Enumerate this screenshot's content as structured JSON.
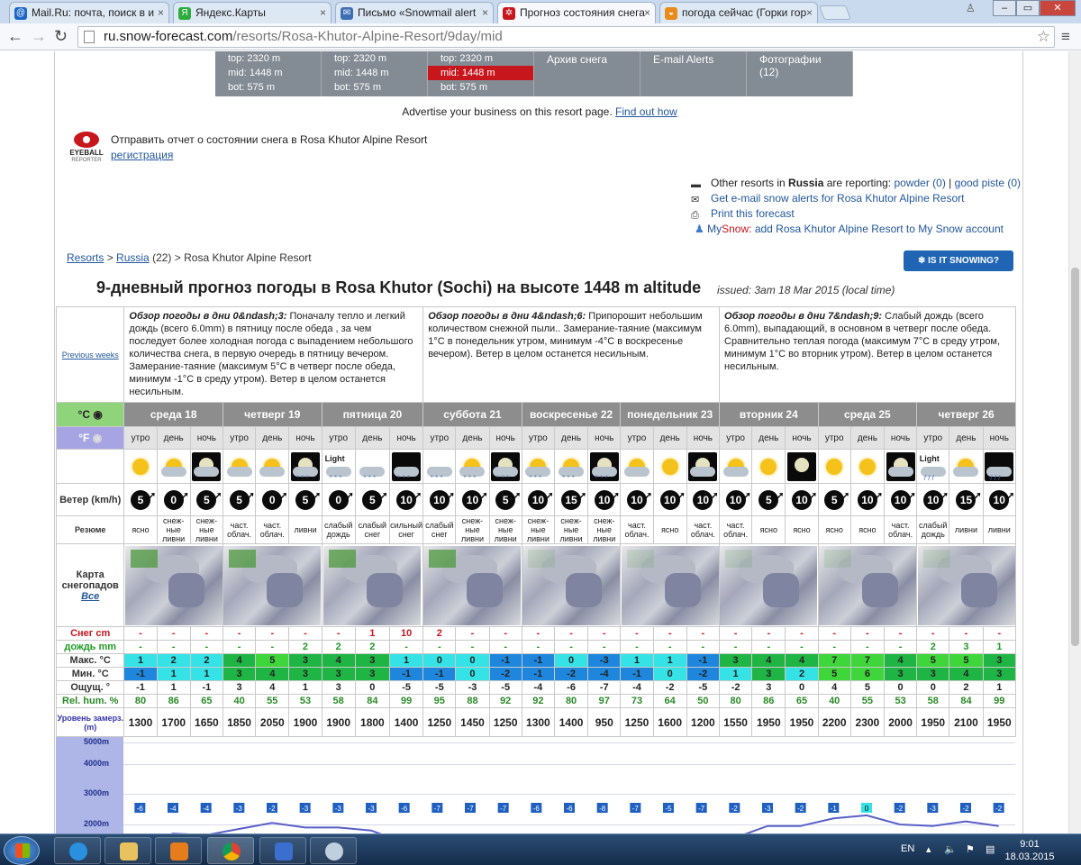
{
  "browser": {
    "tabs": [
      {
        "label": "Mail.Ru: почта, поиск в и",
        "icon_color": "#1b67c7",
        "icon": "@",
        "active": false
      },
      {
        "label": "Яндекс.Карты",
        "icon_color": "#2bac3b",
        "icon": "Я",
        "active": false
      },
      {
        "label": "Письмо «Snowmail alert",
        "icon_color": "#3f6fb3",
        "icon": "✉",
        "active": false
      },
      {
        "label": "Прогноз состояния снега",
        "icon_color": "#c8161d",
        "icon": "✲",
        "active": true
      },
      {
        "label": "погода сейчас (Горки гор",
        "icon_color": "#e88b1a",
        "icon": "◒",
        "active": false
      }
    ],
    "url_host": "ru.snow-forecast.com",
    "url_path": "/resorts/Rosa-Khutor-Alpine-Resort/9day/mid",
    "back_icon": "back-arrow-icon",
    "forward_icon": "forward-arrow-icon",
    "reload_icon": "reload-icon"
  },
  "resort_nav": [
    [
      "top: 2320 m",
      "mid: 1448 m",
      "bot: 575 m"
    ],
    [
      "top: 2320 m",
      "mid: 1448 m",
      "bot: 575 m"
    ],
    [
      "top: 2320 m",
      "mid: 1448 m",
      "bot: 575 m"
    ]
  ],
  "resort_links": [
    "Архив снега",
    "E-mail Alerts",
    "Фотографии (12)"
  ],
  "advertise": {
    "text": "Advertise your business on this resort page.",
    "link": "Find out how"
  },
  "eyeball": {
    "logo_top": "EYEBALL",
    "logo_bottom": "REPORTER",
    "text": "Отправить отчет о состоянии снега в Rosa Khutor Alpine Resort",
    "link": "регистрация"
  },
  "other": {
    "p1": "Other resorts in",
    "country": "Russia",
    "p2": "are reporting:",
    "powder": "powder (0)",
    "sep": "|",
    "piste": "good piste (0)",
    "alerts": "Get e-mail snow alerts for Rosa Khutor Alpine Resort",
    "print": "Print this forecast",
    "mysnow_a": "My",
    "mysnow_b": "Snow:",
    "mysnow_c": "add Rosa Khutor Alpine Resort to My Snow account"
  },
  "crumbs": {
    "resorts": "Resorts",
    "sep1": ">",
    "russia": "Russia",
    "count": "(22)",
    "sep2": ">",
    "resort": "Rosa Khutor Alpine Resort"
  },
  "is_snowing": "❄ IS IT SNOWING?",
  "title": "9-дневный прогноз погоды в Rosa Khutor (Sochi) на высоте 1448 m altitude",
  "issued": "issued: 3am 18 Mar 2015 (local time)",
  "prev_weeks": "Previous weeks",
  "summaries": [
    {
      "head": "Обзор погоды в дни 0&ndash;3:",
      "text": "Поначалу тепло и легкий дождь (всего 6.0mm) в пятницу после обеда , за чем последует более холодная погода с выпадением небольшого количества снега, в первую очередь в пятницу вечером. Замерание-таяние (максимум 5°C в четверг после обеда, минимум -1°C в среду утром). Ветер в целом останется несильным."
    },
    {
      "head": "Обзор погоды в дни 4&ndash;6:",
      "text": "Припорошит небольшим количеством снежной пыли.. Замерание-таяние (максимум 1°C в понедельник утром, минимум -4°C в воскресенье вечером). Ветер в целом останется несильным."
    },
    {
      "head": "Обзор погоды в дни 7&ndash;9:",
      "text": "Слабый дождь (всего 6.0mm), выпадающий, в основном в четверг после обеда. Сравнительно теплая погода (максимум 7°C в среду утром, минимум 1°C во вторник утром). Ветер в целом останется несильным."
    }
  ],
  "unit_c": "°C",
  "unit_f": "°F",
  "days": [
    "среда 18",
    "четверг 19",
    "пятница 20",
    "суббота 21",
    "воскресенье 22",
    "понедельник 23",
    "вторник 24",
    "среда 25",
    "четверг 26"
  ],
  "tod": [
    "утро",
    "день",
    "ночь"
  ],
  "labels": {
    "wind": "Ветер (km/h)",
    "summary": "Резюме",
    "map": "Карта снегопадов",
    "map_all": "Все",
    "snow": "Снег cm",
    "rain": "дождь mm",
    "max": "Макс. °C",
    "min": "Мин. °C",
    "feels": "Ощущ. °",
    "hum": "Rel. hum. %",
    "freeze": "Уровень замерз. (m)"
  },
  "weather_icons": [
    "sun",
    "cloud-sun",
    "moon-cloud",
    "cloud-sun",
    "cloud-sun",
    "cloud-moon-snow",
    "light-snow",
    "snow-cloud",
    "night-snow",
    "snow-cloud",
    "cloud-sun-snow",
    "moon-snow",
    "cloud-sun-snow",
    "cloud-sun-snow",
    "moon-snow",
    "cloud-sun",
    "sun",
    "moon-cloud",
    "cloud-sun",
    "sun",
    "moon",
    "sun",
    "sun",
    "cloud-moon",
    "light-rain",
    "cloud-sun",
    "night-rain"
  ],
  "light_label": "Light",
  "wind": [
    "5",
    "0",
    "5",
    "5",
    "0",
    "5",
    "0",
    "5",
    "10",
    "10",
    "10",
    "5",
    "10",
    "15",
    "10",
    "10",
    "10",
    "10",
    "10",
    "5",
    "10",
    "5",
    "10",
    "10",
    "10",
    "15",
    "10"
  ],
  "summary": [
    "ясно",
    "снеж-ные ливни",
    "снеж-ные ливни",
    "част. облач.",
    "част. облач.",
    "ливни",
    "слабый дождь",
    "слабый снег",
    "сильный снег",
    "слабый снег",
    "снеж-ные ливни",
    "снеж-ные ливни",
    "снеж-ные ливни",
    "снеж-ные ливни",
    "снеж-ные ливни",
    "част. облач.",
    "ясно",
    "част. облач.",
    "част. облач.",
    "ясно",
    "ясно",
    "ясно",
    "ясно",
    "част. облач.",
    "слабый дождь",
    "ливни",
    "ливни"
  ],
  "snow": [
    "-",
    "-",
    "-",
    "-",
    "-",
    "-",
    "-",
    "1",
    "10",
    "2",
    "-",
    "-",
    "-",
    "-",
    "-",
    "-",
    "-",
    "-",
    "-",
    "-",
    "-",
    "-",
    "-",
    "-",
    "-",
    "-",
    "-"
  ],
  "rain": [
    "-",
    "-",
    "-",
    "-",
    "-",
    "2",
    "2",
    "2",
    "-",
    "-",
    "-",
    "-",
    "-",
    "-",
    "-",
    "-",
    "-",
    "-",
    "-",
    "-",
    "-",
    "-",
    "-",
    "-",
    "2",
    "3",
    "1"
  ],
  "max": [
    "1",
    "2",
    "2",
    "4",
    "5",
    "3",
    "4",
    "3",
    "1",
    "0",
    "0",
    "-1",
    "-1",
    "0",
    "-3",
    "1",
    "1",
    "-1",
    "3",
    "4",
    "4",
    "7",
    "7",
    "4",
    "5",
    "5",
    "3"
  ],
  "min": [
    "-1",
    "1",
    "1",
    "3",
    "4",
    "3",
    "3",
    "3",
    "-1",
    "-1",
    "0",
    "-2",
    "-1",
    "-2",
    "-4",
    "-1",
    "0",
    "-2",
    "1",
    "3",
    "2",
    "5",
    "6",
    "3",
    "3",
    "4",
    "3"
  ],
  "feels": [
    "-1",
    "1",
    "-1",
    "3",
    "4",
    "1",
    "3",
    "0",
    "-5",
    "-5",
    "-3",
    "-5",
    "-4",
    "-6",
    "-7",
    "-4",
    "-2",
    "-5",
    "-2",
    "3",
    "0",
    "4",
    "5",
    "0",
    "0",
    "2",
    "1"
  ],
  "hum": [
    "80",
    "86",
    "65",
    "40",
    "55",
    "53",
    "58",
    "84",
    "99",
    "95",
    "88",
    "92",
    "92",
    "80",
    "97",
    "73",
    "64",
    "50",
    "80",
    "86",
    "65",
    "40",
    "55",
    "53",
    "58",
    "84",
    "99"
  ],
  "freeze": [
    "1300",
    "1700",
    "1650",
    "1850",
    "2050",
    "1900",
    "1900",
    "1800",
    "1400",
    "1250",
    "1450",
    "1250",
    "1300",
    "1400",
    "950",
    "1250",
    "1600",
    "1200",
    "1550",
    "1950",
    "1950",
    "2200",
    "2300",
    "2000",
    "1950",
    "2100",
    "1950"
  ],
  "chart_axis": [
    "5000m",
    "4000m",
    "3000m",
    "2000m"
  ],
  "chart_temps": [
    "-6",
    "-4",
    "-4",
    "-3",
    "-2",
    "-3",
    "-3",
    "-3",
    "-6",
    "-7",
    "-7",
    "-7",
    "-6",
    "-6",
    "-8",
    "-7",
    "-5",
    "-7",
    "-2",
    "-3",
    "-2",
    "-1",
    "0",
    "-2",
    "-3",
    "-2",
    "-2"
  ],
  "taskbar": {
    "lang": "EN",
    "time": "9:01",
    "date": "18.03.2015"
  }
}
